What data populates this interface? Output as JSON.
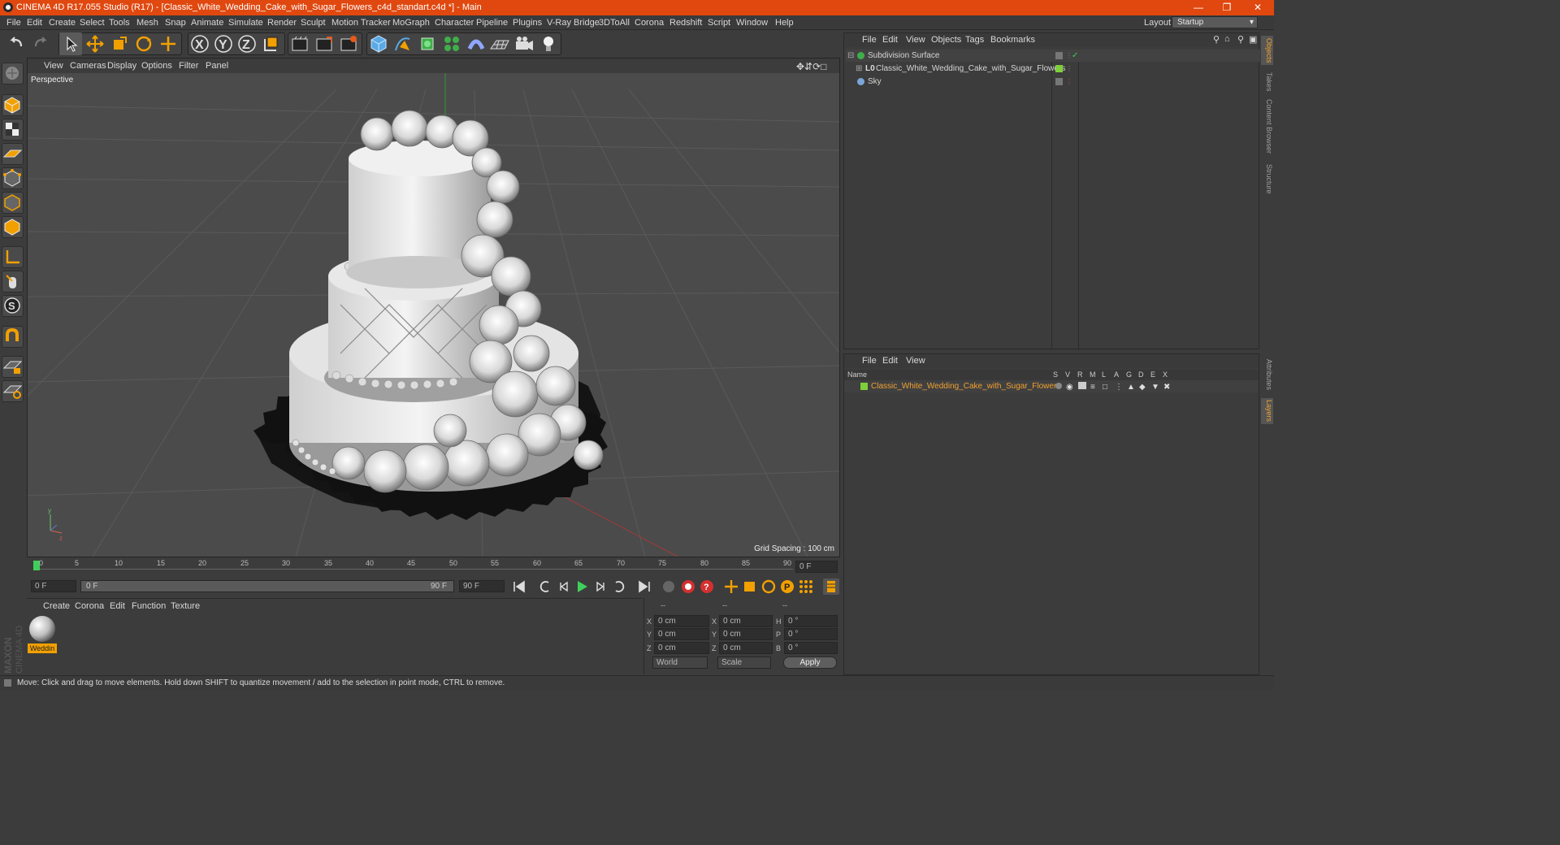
{
  "title": "CINEMA 4D R17.055 Studio (R17) - [Classic_White_Wedding_Cake_with_Sugar_Flowers_c4d_standart.c4d *] - Main",
  "menu": [
    "File",
    "Edit",
    "Create",
    "Select",
    "Tools",
    "Mesh",
    "Snap",
    "Animate",
    "Simulate",
    "Render",
    "Sculpt",
    "Motion Tracker",
    "MoGraph",
    "Character",
    "Pipeline",
    "Plugins",
    "V-Ray Bridge",
    "3DToAll",
    "Corona",
    "Redshift",
    "Script",
    "Window",
    "Help"
  ],
  "layout": {
    "label": "Layout:",
    "value": "Startup"
  },
  "viewport": {
    "menu": [
      "View",
      "Cameras",
      "Display",
      "Options",
      "Filter",
      "Panel"
    ],
    "label": "Perspective",
    "grid_spacing": "Grid Spacing : 100 cm"
  },
  "timeline": {
    "ticks": [
      "0",
      "5",
      "10",
      "15",
      "20",
      "25",
      "30",
      "35",
      "40",
      "45",
      "50",
      "55",
      "60",
      "65",
      "70",
      "75",
      "80",
      "85",
      "90"
    ],
    "current_frame": "0 F"
  },
  "transport": {
    "start": "0 F",
    "range_start": "0 F",
    "range_end": "90 F",
    "end": "90 F"
  },
  "material_manager": {
    "menu": [
      "Create",
      "Corona",
      "Edit",
      "Function",
      "Texture"
    ],
    "material_name": "Weddin"
  },
  "coordinates": {
    "headers": [
      "--",
      "--",
      "--"
    ],
    "rows": [
      {
        "a": "X",
        "av": "0 cm",
        "b": "X",
        "bv": "0 cm",
        "c": "H",
        "cv": "0 °"
      },
      {
        "a": "Y",
        "av": "0 cm",
        "b": "Y",
        "bv": "0 cm",
        "c": "P",
        "cv": "0 °"
      },
      {
        "a": "Z",
        "av": "0 cm",
        "b": "Z",
        "bv": "0 cm",
        "c": "B",
        "cv": "0 °"
      }
    ],
    "mode1": "World",
    "mode2": "Scale",
    "apply": "Apply"
  },
  "object_manager": {
    "menu": [
      "File",
      "Edit",
      "View",
      "Objects",
      "Tags",
      "Bookmarks"
    ],
    "objects": [
      "Subdivision Surface",
      "Classic_White_Wedding_Cake_with_Sugar_Flowers",
      "Sky"
    ]
  },
  "layer_manager": {
    "menu": [
      "File",
      "Edit",
      "View"
    ],
    "name_header": "Name",
    "columns": [
      "S",
      "V",
      "R",
      "M",
      "L",
      "A",
      "G",
      "D",
      "E",
      "X"
    ],
    "layer": "Classic_White_Wedding_Cake_with_Sugar_Flowers"
  },
  "side_tabs": [
    "Objects",
    "Takes",
    "Content Browser",
    "Structure",
    "Attributes",
    "Layers"
  ],
  "brand": "MAXON CINEMA 4D",
  "status": "Move: Click and drag to move elements. Hold down SHIFT to quantize movement / add to the selection in point mode, CTRL to remove.",
  "colors": {
    "accent": "#e0480f",
    "layer_color": "#7ecf3a",
    "highlight": "#f0a030"
  }
}
